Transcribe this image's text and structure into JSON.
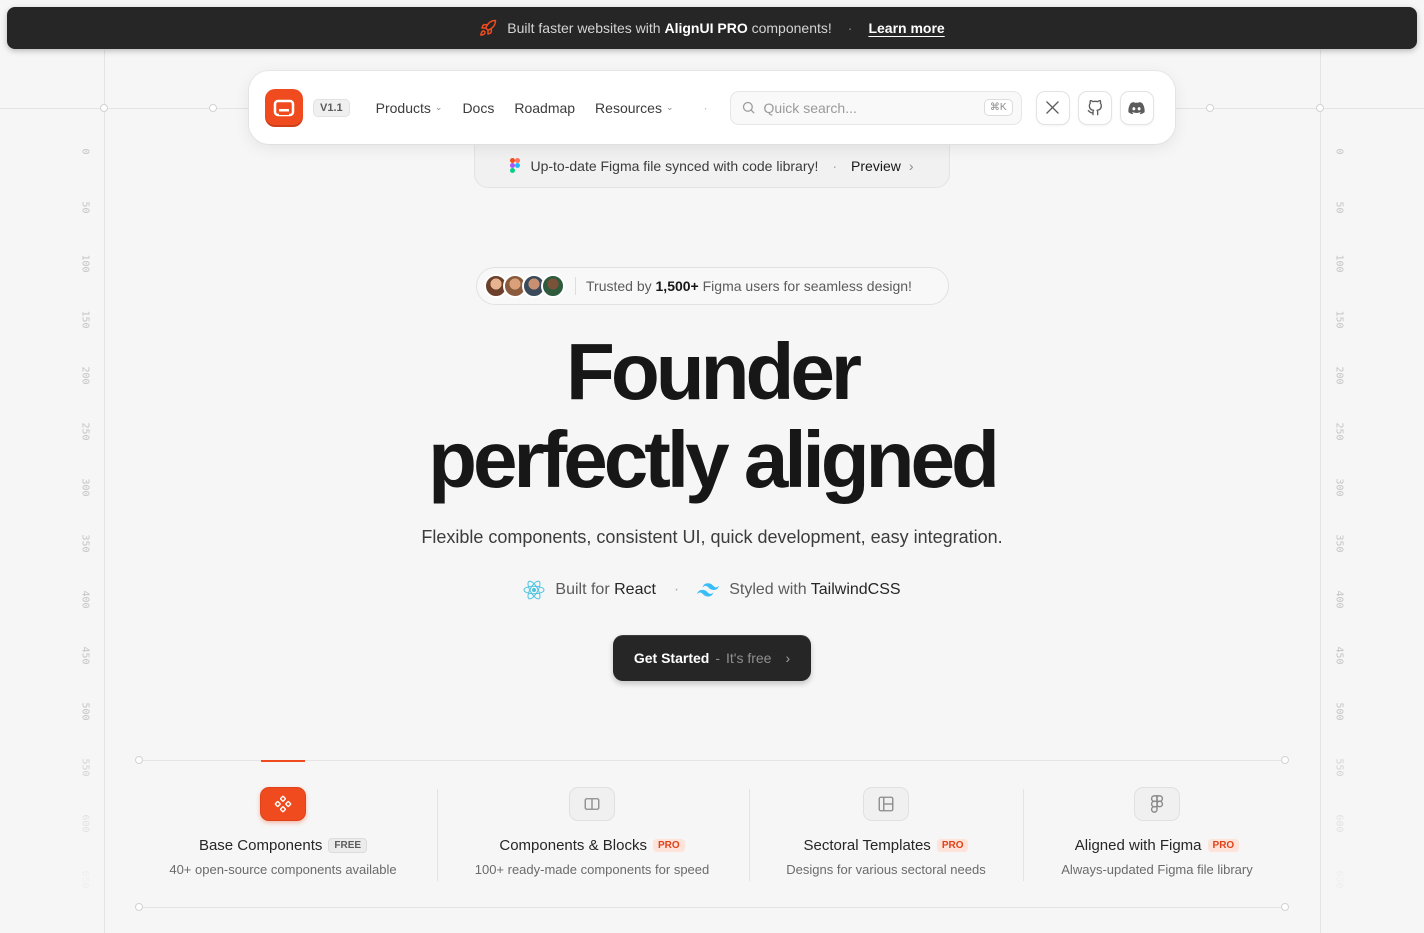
{
  "announcement": {
    "text_before": "Built faster websites with",
    "brand": "AlignUI PRO",
    "text_after": "components!",
    "separator": "·",
    "link": "Learn more"
  },
  "nav": {
    "version": "V1.1",
    "menu": [
      {
        "label": "Products",
        "has_dropdown": true
      },
      {
        "label": "Docs",
        "has_dropdown": false
      },
      {
        "label": "Roadmap",
        "has_dropdown": false
      },
      {
        "label": "Resources",
        "has_dropdown": true
      }
    ],
    "separator": "·",
    "search_placeholder": "Quick search...",
    "search_shortcut": "⌘K",
    "social": [
      "x-icon",
      "github-icon",
      "discord-icon"
    ]
  },
  "figma_banner": {
    "text": "Up-to-date Figma file synced with code library!",
    "separator": "·",
    "link": "Preview"
  },
  "trust": {
    "prefix": "Trusted by",
    "count": "1,500+",
    "suffix": "Figma users for seamless design!"
  },
  "hero": {
    "title_line1": "Founder",
    "title_line2": "perfectly aligned",
    "subtitle": "Flexible components, consistent UI, quick development, easy integration.",
    "built_prefix": "Built for",
    "built_tech": "React",
    "styled_prefix": "Styled with",
    "styled_tech": "TailwindCSS",
    "separator": "·"
  },
  "cta": {
    "label": "Get Started",
    "dash": "-",
    "sub": "It's free",
    "arrow": "›"
  },
  "features": [
    {
      "title": "Base Components",
      "badge": "FREE",
      "desc": "40+ open-source components available",
      "icon": "components-icon"
    },
    {
      "title": "Components & Blocks",
      "badge": "PRO",
      "desc": "100+ ready-made components for speed",
      "icon": "columns-icon"
    },
    {
      "title": "Sectoral Templates",
      "badge": "PRO",
      "desc": "Designs for various sectoral needs",
      "icon": "layout-icon"
    },
    {
      "title": "Aligned with Figma",
      "badge": "PRO",
      "desc": "Always-updated Figma file library",
      "icon": "figma-icon"
    }
  ],
  "ruler": [
    "0",
    "50",
    "100",
    "150",
    "200",
    "250",
    "300",
    "350",
    "400",
    "450",
    "500",
    "550",
    "600",
    "650"
  ],
  "colors": {
    "accent": "#f04b1e",
    "dark": "#262626",
    "background": "#f6f6f6"
  }
}
